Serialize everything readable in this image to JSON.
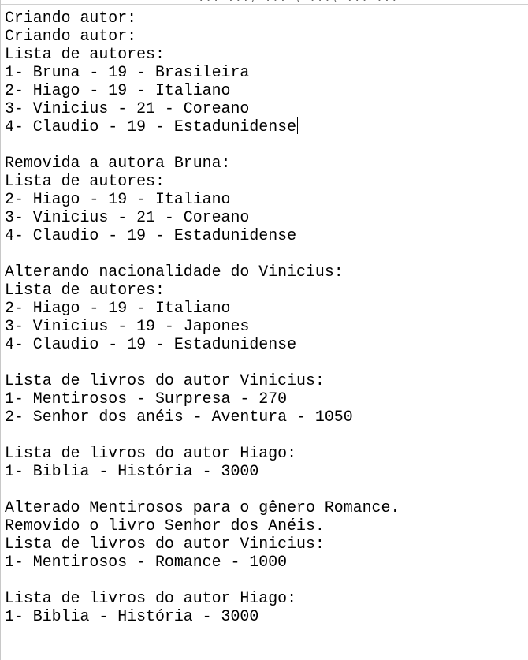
{
  "console": {
    "top_strip": "... ...) ... ( ...( ... ...",
    "lines": [
      "Criando autor:",
      "Criando autor:",
      "Lista de autores:",
      "1- Bruna - 19 - Brasileira",
      "2- Hiago - 19 - Italiano",
      "3- Vinicius - 21 - Coreano",
      "4- Claudio - 19 - Estadunidense",
      "",
      "Removida a autora Bruna:",
      "Lista de autores:",
      "2- Hiago - 19 - Italiano",
      "3- Vinicius - 21 - Coreano",
      "4- Claudio - 19 - Estadunidense",
      "",
      "Alterando nacionalidade do Vinicius:",
      "Lista de autores:",
      "2- Hiago - 19 - Italiano",
      "3- Vinicius - 19 - Japones",
      "4- Claudio - 19 - Estadunidense",
      "",
      "Lista de livros do autor Vinicius:",
      "1- Mentirosos - Surpresa - 270",
      "2- Senhor dos anéis - Aventura - 1050",
      "",
      "Lista de livros do autor Hiago:",
      "1- Biblia - História - 3000",
      "",
      "Alterado Mentirosos para o gênero Romance.",
      "Removido o livro Senhor dos Anéis.",
      "Lista de livros do autor Vinicius:",
      "1- Mentirosos - Romance - 1000",
      "",
      "Lista de livros do autor Hiago:",
      "1- Biblia - História - 3000"
    ]
  }
}
